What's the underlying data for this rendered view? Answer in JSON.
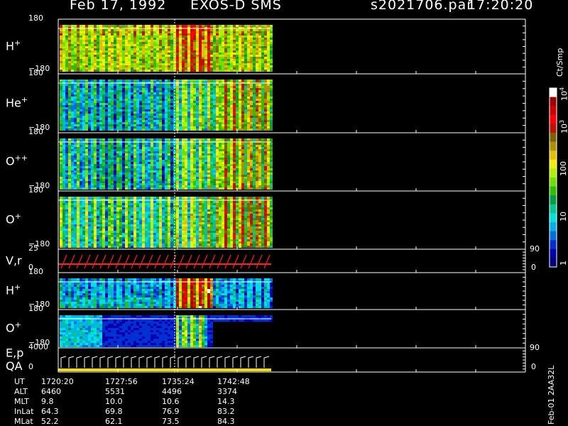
{
  "header": {
    "date": "Feb 17, 1992",
    "instrument": "EXOS-D SMS",
    "file": "s2021706.par",
    "time": "17:20:20"
  },
  "panels": [
    {
      "label": "H",
      "charge": "+",
      "top": "180",
      "bottom": "−180",
      "kind": "spec",
      "pattern": "h"
    },
    {
      "label": "He",
      "charge": "+",
      "top": "180",
      "bottom": "−180",
      "kind": "spec",
      "pattern": "he"
    },
    {
      "label": "O",
      "charge": "++",
      "top": "180",
      "bottom": "−180",
      "kind": "spec",
      "pattern": "opp"
    },
    {
      "label": "O",
      "charge": "+",
      "top": "180",
      "bottom": "−180",
      "kind": "spec",
      "pattern": "op"
    },
    {
      "label": "V,r",
      "charge": "",
      "top": "25",
      "bottom": "0",
      "kind": "line",
      "right_top": "90",
      "right_bottom": "0"
    },
    {
      "label": "H",
      "charge": "+",
      "top": "180",
      "bottom": "−180",
      "kind": "spec",
      "pattern": "h2"
    },
    {
      "label": "O",
      "charge": "+",
      "top": "180",
      "bottom": "−180",
      "kind": "spec",
      "pattern": "o2"
    },
    {
      "label": "E,p",
      "label2": "QA",
      "charge": "",
      "top": "4000",
      "bottom": "0",
      "kind": "ep",
      "right_top": "90",
      "right_bottom": "0"
    }
  ],
  "colorbar": {
    "unit": "Ct/Smp",
    "ticks": [
      "1",
      "10",
      "100",
      "10",
      "10"
    ],
    "tick_exp": [
      "",
      "",
      "",
      "3",
      "4"
    ],
    "colors": [
      "#000080",
      "#0000b0",
      "#0030d0",
      "#0070e0",
      "#00b0e8",
      "#00e0e0",
      "#00c890",
      "#00a040",
      "#30c000",
      "#70e000",
      "#b0f000",
      "#f0f000",
      "#e0c000",
      "#b09000",
      "#806000",
      "#c01000",
      "#ff0000",
      "#d00000",
      "#a00000",
      "#ffffff"
    ]
  },
  "footer": {
    "rows": [
      {
        "name": "UT",
        "values": [
          "1720:20",
          "1727:56",
          "1735:24",
          "1742:48"
        ]
      },
      {
        "name": "ALT",
        "values": [
          "6460",
          "5531",
          "4496",
          "3374"
        ]
      },
      {
        "name": "MLT",
        "values": [
          "9.8",
          "10.0",
          "10.6",
          "14.3"
        ]
      },
      {
        "name": "InLat",
        "values": [
          "64.3",
          "69.8",
          "76.9",
          "83.2"
        ]
      },
      {
        "name": "MLat",
        "values": [
          "52.2",
          "62.1",
          "73.5",
          "84.3"
        ]
      }
    ],
    "code": "Feb-01 2AA32L"
  },
  "chart_data": {
    "type": "heatmap",
    "x_axis": "UT",
    "x": [
      "1720:20",
      "1727:56",
      "1735:24",
      "1742:48"
    ],
    "panels": [
      "H+",
      "He+",
      "O++",
      "O+",
      "V,r",
      "H+",
      "O+",
      "E,p"
    ],
    "ylim_pitch": [
      -180,
      180
    ],
    "color_scale": "log",
    "color_range": [
      1,
      10000
    ],
    "colorbar_label": "Ct/Smp",
    "vr_range": [
      0,
      25
    ],
    "ep_range": [
      0,
      4000
    ]
  }
}
